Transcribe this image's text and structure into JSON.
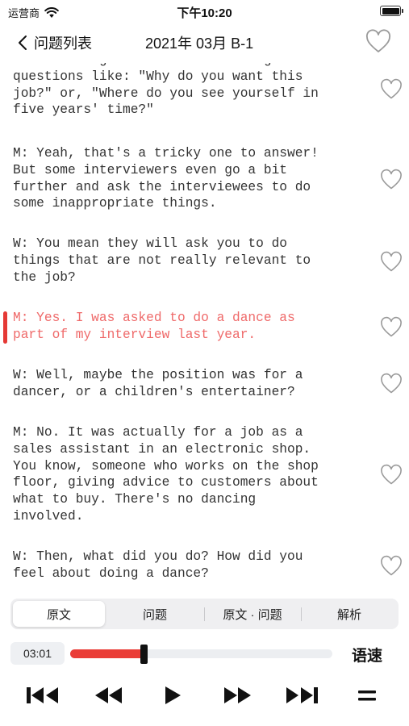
{
  "status_bar": {
    "carrier": "运营商",
    "time": "下午10:20"
  },
  "nav": {
    "back_label": "问题列表",
    "title": "2021年 03月 B-1"
  },
  "transcript": [
    {
      "text": "W: Yes. I agree. I hate answering\nquestions like: \"Why do you want this\njob?\" or, \"Where do you see yourself in\nfive years' time?\"",
      "active": false
    },
    {
      "text": "M: Yeah, that's a tricky one to answer!\nBut some interviewers even go a bit\nfurther and ask the interviewees to do\nsome inappropriate things.",
      "active": false
    },
    {
      "text": "W: You mean they will ask you to do\nthings that are not really relevant to\nthe job?",
      "active": false
    },
    {
      "text": "M: Yes. I was asked to do a dance as\npart of my interview last year.",
      "active": true
    },
    {
      "text": "W: Well, maybe the position was for a\ndancer, or a children's entertainer?",
      "active": false
    },
    {
      "text": "M: No. It was actually for a job as a\nsales assistant in an electronic shop.\nYou know, someone who works on the shop\nfloor, giving advice to customers about\nwhat to buy. There's no dancing\ninvolved.",
      "active": false
    },
    {
      "text": "W: Then, what did you do? How did you\nfeel about doing a dance?",
      "active": false
    }
  ],
  "tabs": [
    {
      "label": "原文",
      "selected": true
    },
    {
      "label": "问题",
      "selected": false
    },
    {
      "label": "原文 · 问题",
      "selected": false
    },
    {
      "label": "解析",
      "selected": false
    }
  ],
  "player": {
    "current_time": "03:01",
    "progress": 0.28,
    "speed_label": "语速"
  },
  "colors": {
    "accent": "#e53935",
    "active_text": "#ef6a6a"
  },
  "icons": [
    "wifi-icon",
    "battery-icon",
    "back-icon",
    "heart-icon",
    "skip-back-icon",
    "rewind-icon",
    "play-icon",
    "fast-forward-icon",
    "skip-forward-icon",
    "menu-icon"
  ]
}
